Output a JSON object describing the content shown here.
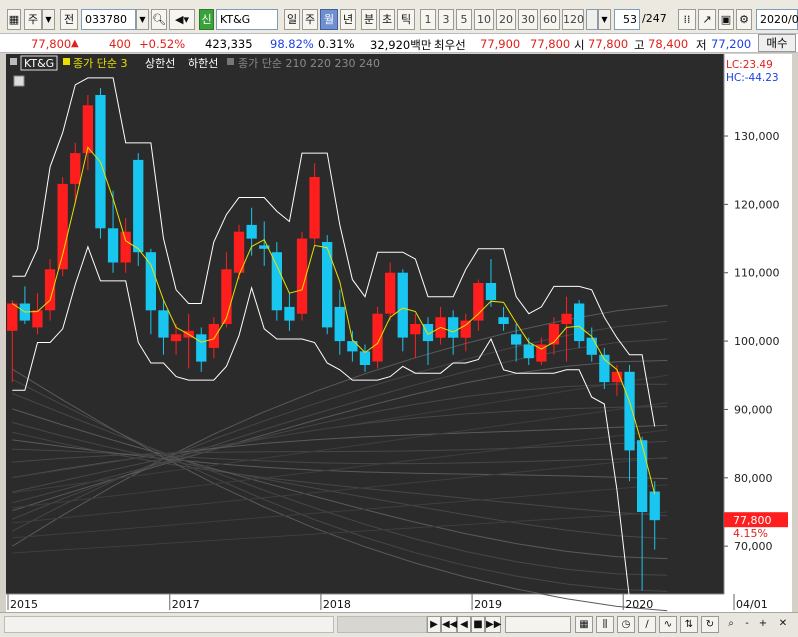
{
  "toolbar": {
    "market_type": "주",
    "prev_label": "전",
    "stock_code": "033780",
    "sin_badge": "신",
    "stock_name": "KT&G",
    "period_tabs": [
      "일",
      "주",
      "월",
      "년"
    ],
    "selected_period": "월",
    "interval_tabs": [
      "분",
      "초",
      "틱"
    ],
    "numbers": [
      "1",
      "3",
      "5",
      "10",
      "20",
      "30",
      "60",
      "120"
    ],
    "count": "53",
    "total": "/247",
    "date": "2020/0"
  },
  "quote": {
    "price": "77,800",
    "change_arrow": "▲",
    "change": "400",
    "change_pct": "+0.52%",
    "volume": "423,335",
    "vol_ratio": "98.82%",
    "turnover": "0.31%",
    "amount": "32,920백만",
    "priority_label": "최우선",
    "bid_price1": "77,900",
    "bid_price2": "77,800",
    "open_label": "시",
    "open": "77,800",
    "high_label": "고",
    "high": "78,400",
    "low_label": "저",
    "low": "77,200",
    "action_button": "매수"
  },
  "legend": {
    "name": "KT&G",
    "line1": "종가 단순 3",
    "line2": "상한선",
    "line3": "하한선",
    "line4": "종가 단순 210 220 230 240"
  },
  "chart_data": {
    "type": "candlestick",
    "interval": "monthly",
    "y_axis": {
      "ticks": [
        70000,
        80000,
        90000,
        100000,
        110000,
        120000,
        130000
      ],
      "tick_labels": [
        "70,000",
        "80,000",
        "90,000",
        "100,000",
        "110,000",
        "120,000",
        "130,000"
      ],
      "range": [
        63000,
        142000
      ]
    },
    "x_axis": {
      "labels": [
        "2015",
        "2017",
        "2018",
        "2019",
        "2020",
        "04/01"
      ],
      "label_index": [
        0,
        13,
        25,
        37,
        49,
        56
      ]
    },
    "last_price_label": "77,800",
    "last_pct_label": "4.15%",
    "lc_label": "LC:23.49",
    "hc_label": "HC:-44.23",
    "colors": {
      "up": "#ff1e1e",
      "down": "#19c6f0",
      "ma": "#e8e000",
      "band": "#ffffff",
      "bg": "#2b2b2b"
    },
    "candles": [
      {
        "o": 101500,
        "h": 106000,
        "l": 94000,
        "c": 105500
      },
      {
        "o": 105500,
        "h": 108000,
        "l": 102500,
        "c": 103000
      },
      {
        "o": 102000,
        "h": 107000,
        "l": 101000,
        "c": 104500
      },
      {
        "o": 104500,
        "h": 112000,
        "l": 103000,
        "c": 110500
      },
      {
        "o": 110500,
        "h": 124000,
        "l": 109500,
        "c": 123000
      },
      {
        "o": 123000,
        "h": 129000,
        "l": 120000,
        "c": 127500
      },
      {
        "o": 127500,
        "h": 136000,
        "l": 125000,
        "c": 134500
      },
      {
        "o": 136000,
        "h": 137000,
        "l": 115000,
        "c": 116500
      },
      {
        "o": 116500,
        "h": 122000,
        "l": 110000,
        "c": 111500
      },
      {
        "o": 111500,
        "h": 118000,
        "l": 110000,
        "c": 116000
      },
      {
        "o": 126500,
        "h": 127500,
        "l": 111000,
        "c": 113000
      },
      {
        "o": 113000,
        "h": 113500,
        "l": 101000,
        "c": 104500
      },
      {
        "o": 104500,
        "h": 106000,
        "l": 98000,
        "c": 100500
      },
      {
        "o": 100000,
        "h": 102500,
        "l": 98000,
        "c": 101000
      },
      {
        "o": 100500,
        "h": 104000,
        "l": 96000,
        "c": 101500
      },
      {
        "o": 101000,
        "h": 102000,
        "l": 95500,
        "c": 97000
      },
      {
        "o": 99000,
        "h": 103500,
        "l": 97500,
        "c": 102500
      },
      {
        "o": 102500,
        "h": 113000,
        "l": 102000,
        "c": 110500
      },
      {
        "o": 110000,
        "h": 117000,
        "l": 109000,
        "c": 116000
      },
      {
        "o": 117000,
        "h": 119500,
        "l": 112500,
        "c": 115000
      },
      {
        "o": 114000,
        "h": 117500,
        "l": 111000,
        "c": 113500
      },
      {
        "o": 113000,
        "h": 114500,
        "l": 103000,
        "c": 104500
      },
      {
        "o": 105000,
        "h": 107000,
        "l": 101500,
        "c": 103000
      },
      {
        "o": 104000,
        "h": 116000,
        "l": 103000,
        "c": 115000
      },
      {
        "o": 115000,
        "h": 126000,
        "l": 114000,
        "c": 124000
      },
      {
        "o": 114500,
        "h": 115500,
        "l": 101000,
        "c": 102000
      },
      {
        "o": 105000,
        "h": 107500,
        "l": 98000,
        "c": 100000
      },
      {
        "o": 100000,
        "h": 101500,
        "l": 97000,
        "c": 98500
      },
      {
        "o": 98500,
        "h": 99500,
        "l": 95500,
        "c": 96500
      },
      {
        "o": 97000,
        "h": 105000,
        "l": 96000,
        "c": 104000
      },
      {
        "o": 104000,
        "h": 111500,
        "l": 103000,
        "c": 110000
      },
      {
        "o": 110000,
        "h": 110500,
        "l": 98500,
        "c": 100500
      },
      {
        "o": 101000,
        "h": 104000,
        "l": 97500,
        "c": 102500
      },
      {
        "o": 102500,
        "h": 103500,
        "l": 96500,
        "c": 100000
      },
      {
        "o": 100500,
        "h": 105000,
        "l": 99500,
        "c": 103500
      },
      {
        "o": 103500,
        "h": 104500,
        "l": 98000,
        "c": 100500
      },
      {
        "o": 100500,
        "h": 104000,
        "l": 98500,
        "c": 103000
      },
      {
        "o": 103000,
        "h": 109000,
        "l": 101500,
        "c": 108500
      },
      {
        "o": 108500,
        "h": 112000,
        "l": 105000,
        "c": 106000
      },
      {
        "o": 103500,
        "h": 105000,
        "l": 101500,
        "c": 102500
      },
      {
        "o": 101000,
        "h": 102500,
        "l": 97000,
        "c": 99500
      },
      {
        "o": 99500,
        "h": 100500,
        "l": 96500,
        "c": 97500
      },
      {
        "o": 97000,
        "h": 100500,
        "l": 96500,
        "c": 99500
      },
      {
        "o": 99500,
        "h": 103500,
        "l": 98000,
        "c": 102500
      },
      {
        "o": 102500,
        "h": 106500,
        "l": 97000,
        "c": 104000
      },
      {
        "o": 105500,
        "h": 106000,
        "l": 99000,
        "c": 100000
      },
      {
        "o": 100500,
        "h": 102000,
        "l": 97000,
        "c": 98000
      },
      {
        "o": 98000,
        "h": 99000,
        "l": 93000,
        "c": 94000
      },
      {
        "o": 94000,
        "h": 96500,
        "l": 92000,
        "c": 95500
      },
      {
        "o": 95500,
        "h": 96500,
        "l": 79500,
        "c": 84000
      },
      {
        "o": 85500,
        "h": 86000,
        "l": 63500,
        "c": 75000
      },
      {
        "o": 78000,
        "h": 79500,
        "l": 69500,
        "c": 73800
      }
    ]
  },
  "bottombar": {
    "nav_buttons": [
      "▶",
      "◀◀",
      "◀",
      "■",
      "▶▶"
    ],
    "zoom_buttons": [
      "-",
      "+",
      "✕"
    ]
  }
}
